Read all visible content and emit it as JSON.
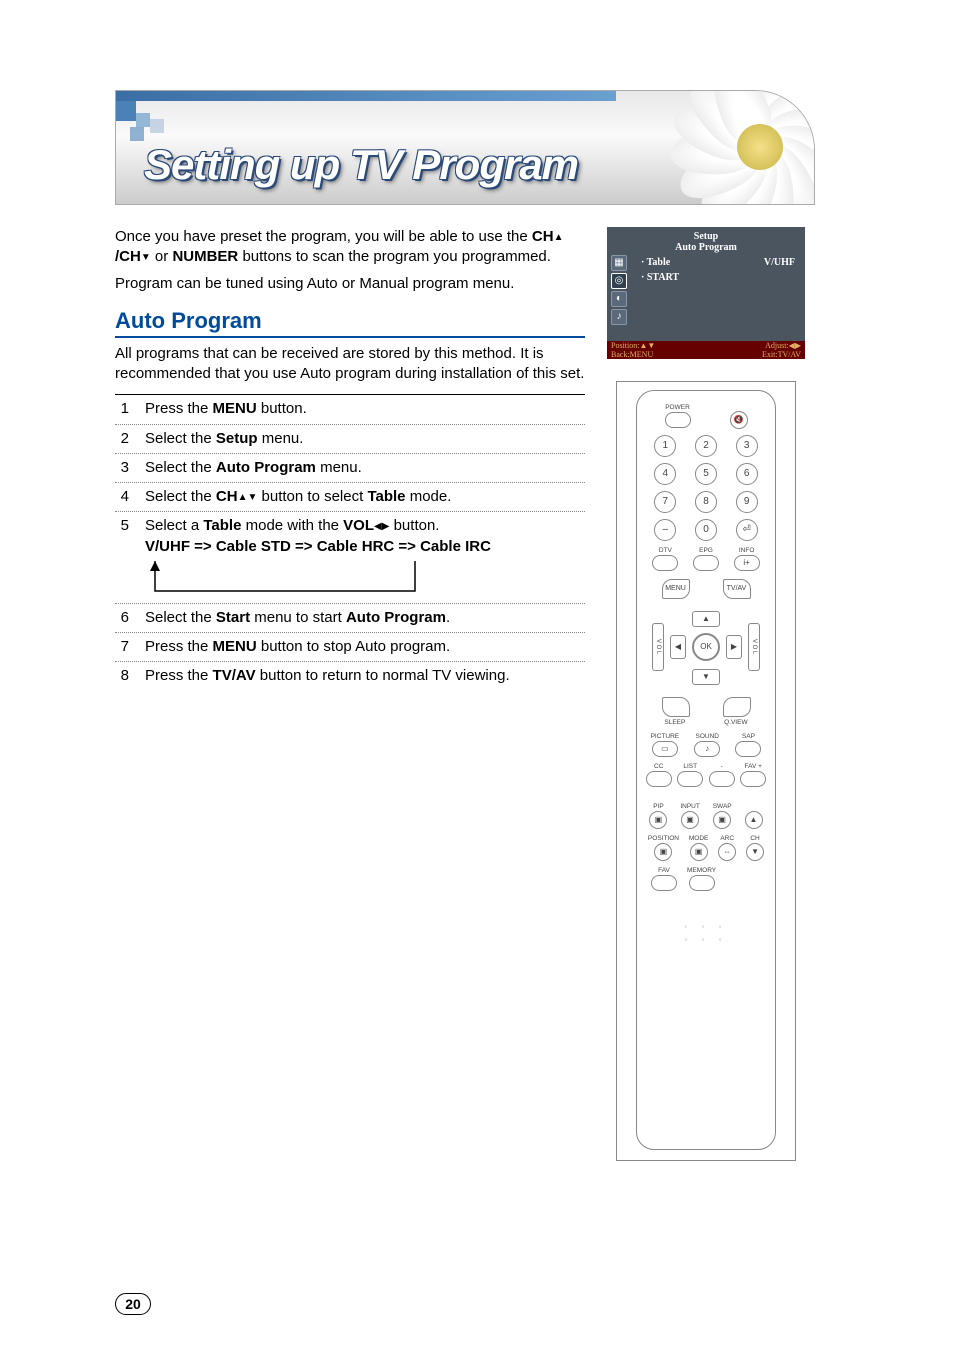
{
  "banner": {
    "title": "Setting up TV Program"
  },
  "intro": {
    "line1_pre": "Once you have preset the program, you will be able to use the ",
    "line1_b1": "CH",
    "line1_b2": "/CH",
    "line1_mid": " or ",
    "line1_b3": "NUMBER",
    "line1_post": " buttons to scan the program you programmed.",
    "line2": "Program can be tuned using Auto or Manual program menu."
  },
  "section_heading": "Auto Program",
  "section_body": "All programs that can be received are stored by this method. It is recommended that you use Auto program during installation of this set.",
  "steps": [
    {
      "n": "1",
      "parts": [
        {
          "t": "Press the "
        },
        {
          "b": "MENU"
        },
        {
          "t": " button."
        }
      ]
    },
    {
      "n": "2",
      "parts": [
        {
          "t": "Select the "
        },
        {
          "b": "Setup"
        },
        {
          "t": " menu."
        }
      ]
    },
    {
      "n": "3",
      "parts": [
        {
          "t": "Select the "
        },
        {
          "b": "Auto Program"
        },
        {
          "t": " menu."
        }
      ]
    },
    {
      "n": "4",
      "parts": [
        {
          "t": "Select the "
        },
        {
          "b": "CH"
        },
        {
          "tri_up": true
        },
        {
          "tri_down": true
        },
        {
          "t": " button to select "
        },
        {
          "b": "Table"
        },
        {
          "t": " mode."
        }
      ]
    },
    {
      "n": "5",
      "parts": [
        {
          "t": "Select a "
        },
        {
          "b": "Table"
        },
        {
          "t": " mode with the "
        },
        {
          "b": "VOL"
        },
        {
          "tri_left": true
        },
        {
          "tri_right": true
        },
        {
          "t": " button."
        }
      ],
      "extra_bold": "V/UHF => Cable STD => Cable HRC => Cable IRC",
      "cycle": true
    },
    {
      "n": "6",
      "parts": [
        {
          "t": "Select the "
        },
        {
          "b": "Start"
        },
        {
          "t": " menu to start "
        },
        {
          "b": "Auto Program"
        },
        {
          "t": "."
        }
      ]
    },
    {
      "n": "7",
      "parts": [
        {
          "t": "Press the "
        },
        {
          "b": "MENU"
        },
        {
          "t": " button to stop Auto program."
        }
      ]
    },
    {
      "n": "8",
      "parts": [
        {
          "t": "Press the "
        },
        {
          "b": "TV/AV"
        },
        {
          "t": " button to return to normal TV viewing."
        }
      ]
    }
  ],
  "osd": {
    "title1": "Setup",
    "title2": "Auto Program",
    "items": [
      "Table",
      "START"
    ],
    "right_value": "V/UHF",
    "bar_left1": "Position:▲▼",
    "bar_left2": "Back:MENU",
    "bar_right1": "Adjust:◀▶",
    "bar_right2": "Exit:TV/AV"
  },
  "remote": {
    "top": {
      "power": "POWER",
      "mute_icon": "mute-icon"
    },
    "numpad": [
      "1",
      "2",
      "3",
      "4",
      "5",
      "6",
      "7",
      "8",
      "9",
      "–",
      "0",
      "⏎"
    ],
    "numpad_labels": [
      "DTV",
      "EPG",
      "INFO"
    ],
    "info_pill": "i+",
    "menu": "MENU",
    "tvav": "TV/AV",
    "dpad": {
      "ok": "OK",
      "up": "▲",
      "down": "▼",
      "left": "◀",
      "right": "▶",
      "vol": "V O L"
    },
    "mid": {
      "sleep": "SLEEP",
      "qview": "Q.VIEW",
      "picture": "PICTURE",
      "sound": "SOUND",
      "sap": "SAP"
    },
    "row_ccfav": [
      "CC",
      "LIST",
      "-",
      "FAV +"
    ],
    "pip": {
      "r1_lbls": [
        "PIP",
        "INPUT",
        "SWAP",
        ""
      ],
      "r2_lbls": [
        "POSITION",
        "MODE",
        "ARC",
        "CH"
      ],
      "r3_lbls": [
        "FAV",
        "MEMORY",
        "",
        ""
      ]
    }
  },
  "page_number": "20"
}
